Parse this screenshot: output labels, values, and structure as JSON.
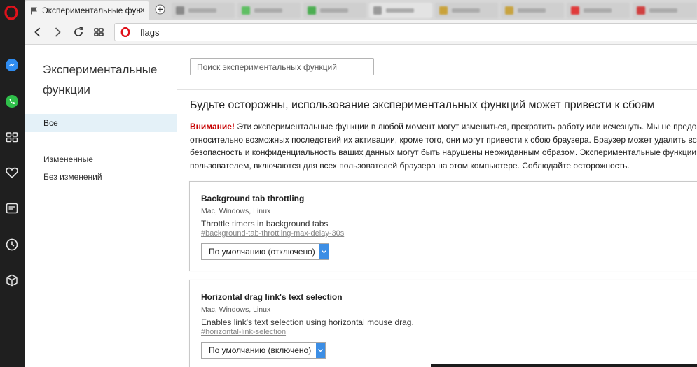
{
  "browser": {
    "active_tab_title": "Экспериментальные функции",
    "tab_close": "×",
    "address": "flags",
    "colors": {
      "opera_red": "#e0121b",
      "sidebar_bg": "#1f1f1f",
      "accent_blue": "#3c8ee5"
    }
  },
  "sidebar_icons": [
    "opera-logo",
    "messenger-icon",
    "whatsapp-icon",
    "speed-dial-icon",
    "heart-icon",
    "news-icon",
    "history-icon",
    "cube-icon"
  ],
  "flags_nav": {
    "title": "Экспериментальные функции",
    "all": "Все",
    "changed": "Измененные",
    "unchanged": "Без изменений"
  },
  "main": {
    "search_placeholder": "Поиск экспериментальных функций",
    "warning_title": "Будьте осторожны, использование экспериментальных функций может привести к сбоям",
    "warning_label": "Внимание!",
    "warning_text": " Эти экспериментальные функции в любой момент могут измениться, прекратить работу или исчезнуть. Мы не предоставляем никаких гарантий относительно возможных последствий их активации, кроме того, они могут привести к сбою браузера. Браузер может удалить все ваши данные, а безопасность и конфиденциальность ваших данных могут быть нарушены неожиданным образом. Экспериментальные функции, выбранные одним пользователем, включаются для всех пользователей браузера на этом компьютере. Соблюдайте осторожность."
  },
  "flags": [
    {
      "title": "Background tab throttling",
      "platforms": "Mac, Windows, Linux",
      "description": "Throttle timers in background tabs",
      "link": "#background-tab-throttling-max-delay-30s",
      "value": "По умолчанию (отключено)"
    },
    {
      "title": "Horizontal drag link's text selection",
      "platforms": "Mac, Windows, Linux",
      "description": "Enables link's text selection using horizontal mouse drag.",
      "link": "#horizontal-link-selection",
      "value": "По умолчанию (включено)"
    }
  ]
}
